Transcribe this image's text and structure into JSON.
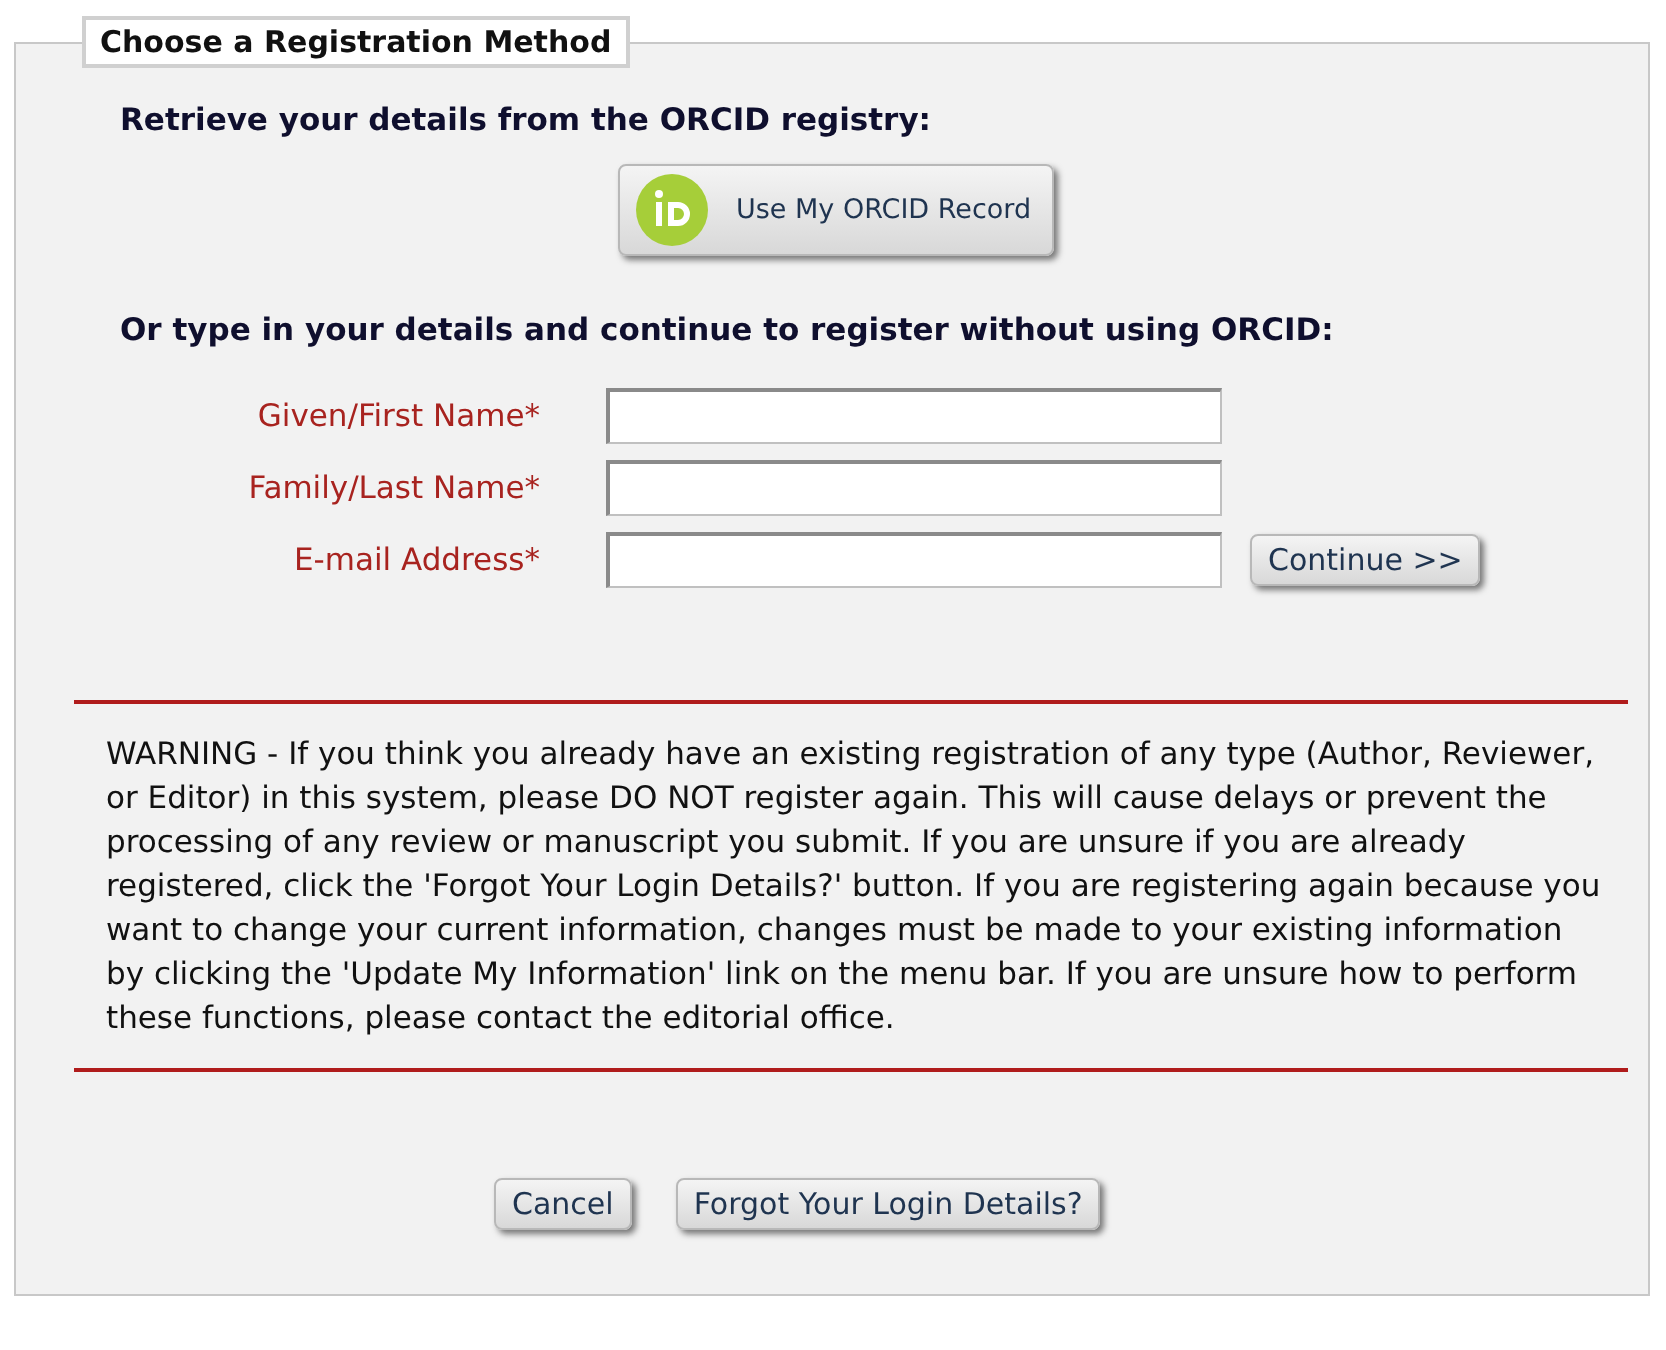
{
  "panel": {
    "title": "Choose a Registration Method"
  },
  "orcid": {
    "heading": "Retrieve your details from the ORCID registry:",
    "button": "Use My ORCID Record"
  },
  "manual": {
    "heading": "Or type in your details and continue to register without using ORCID:",
    "fields": [
      {
        "label": "Given/First Name*"
      },
      {
        "label": "Family/Last Name*"
      },
      {
        "label": "E-mail Address*"
      }
    ],
    "continue_button": "Continue >>"
  },
  "warning": "WARNING - If you think you already have an existing registration of any type (Author, Reviewer, or Editor) in this system, please DO NOT register again. This will cause delays or prevent the processing of any review or manuscript you submit. If you are unsure if you are already registered, click the 'Forgot Your Login Details?' button. If you are registering again because you want to change your current information, changes must be made to your existing information by clicking the 'Update My Information' link on the menu bar. If you are unsure how to perform these functions, please contact the editorial office.",
  "buttons": [
    "Cancel",
    "Forgot Your Login Details?"
  ]
}
